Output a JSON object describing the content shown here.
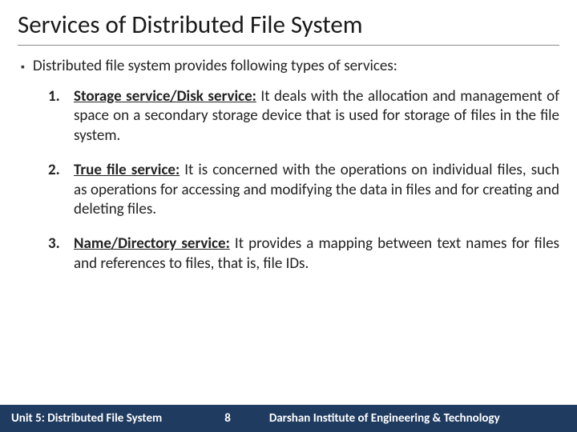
{
  "title": "Services of Distributed File System",
  "intro": "Distributed file system provides following types of services:",
  "items": [
    {
      "num": "1.",
      "head": "Storage service/Disk service:",
      "body": " It deals with the allocation and management of space on a secondary storage device that is used for storage of files in the file system."
    },
    {
      "num": "2.",
      "head": "True file service:",
      "body": " It is concerned with the operations on individual files, such as operations for accessing and modifying the data in files and for creating and deleting files."
    },
    {
      "num": "3.",
      "head": "Name/Directory service:",
      "body": " It provides a mapping between text names for files and references to files, that is, file IDs."
    }
  ],
  "footer": {
    "left": "Unit 5: Distributed File System",
    "center": "8",
    "right": "Darshan Institute of Engineering & Technology"
  }
}
